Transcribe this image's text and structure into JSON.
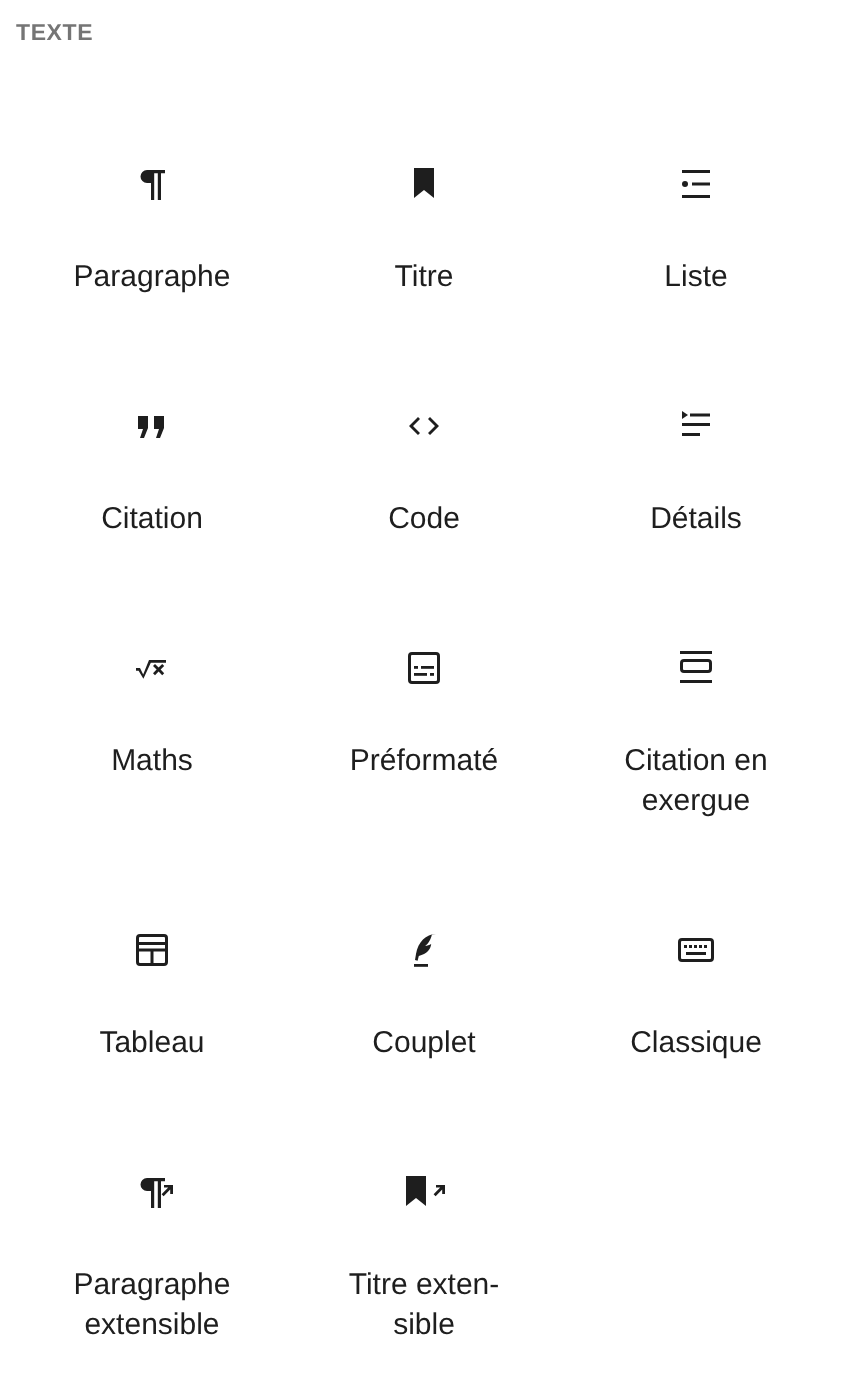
{
  "section": {
    "title": "TEXTE"
  },
  "blocks": [
    {
      "label": "Paragraphe"
    },
    {
      "label": "Titre"
    },
    {
      "label": "Liste"
    },
    {
      "label": "Citation"
    },
    {
      "label": "Code"
    },
    {
      "label": "Détails"
    },
    {
      "label": "Maths"
    },
    {
      "label": "Préformaté"
    },
    {
      "label": "Citation en exergue"
    },
    {
      "label": "Tableau"
    },
    {
      "label": "Couplet"
    },
    {
      "label": "Classique"
    },
    {
      "label": "Paragraphe extensible"
    },
    {
      "label": "Titre exten-sible"
    }
  ]
}
